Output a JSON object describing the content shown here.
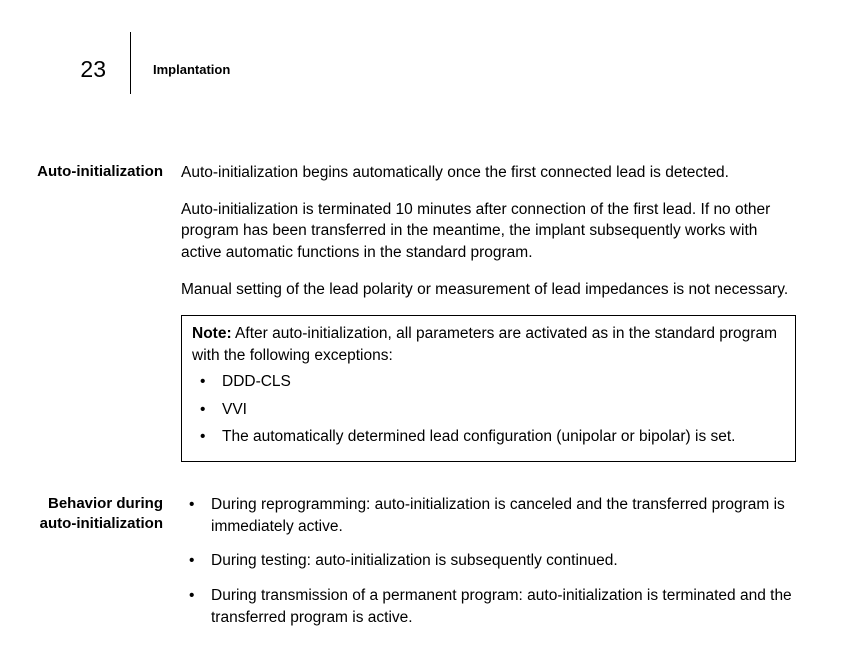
{
  "header": {
    "page_number": "23",
    "chapter": "Implantation"
  },
  "section1": {
    "label": "Auto-initialization",
    "para1": "Auto-initialization begins automatically once the first connected lead is detected.",
    "para2": "Auto-initialization is terminated 10 minutes after connection of the first lead. If no other program has been transferred in the meantime, the implant subsequently works with active automatic functions in the standard program.",
    "para3": "Manual setting of the lead polarity or measurement of lead impedances is not necessary.",
    "note": {
      "label": "Note:",
      "text": " After auto-initialization, all parameters are activated as in the standard program with the following exceptions:",
      "bullets": {
        "b1": "DDD-CLS",
        "b2": "VVI",
        "b3": "The automatically determined lead configuration (unipolar or bipolar) is set."
      }
    }
  },
  "section2": {
    "label_line1": "Behavior during",
    "label_line2": "auto-initialization",
    "bullets": {
      "b1": "During reprogramming:  auto-initialization is canceled and the transferred program is immediately active.",
      "b2": "During testing: auto-initialization is subsequently continued.",
      "b3": "During transmission of a permanent program: auto-initialization is terminated and the transferred program is active."
    }
  }
}
